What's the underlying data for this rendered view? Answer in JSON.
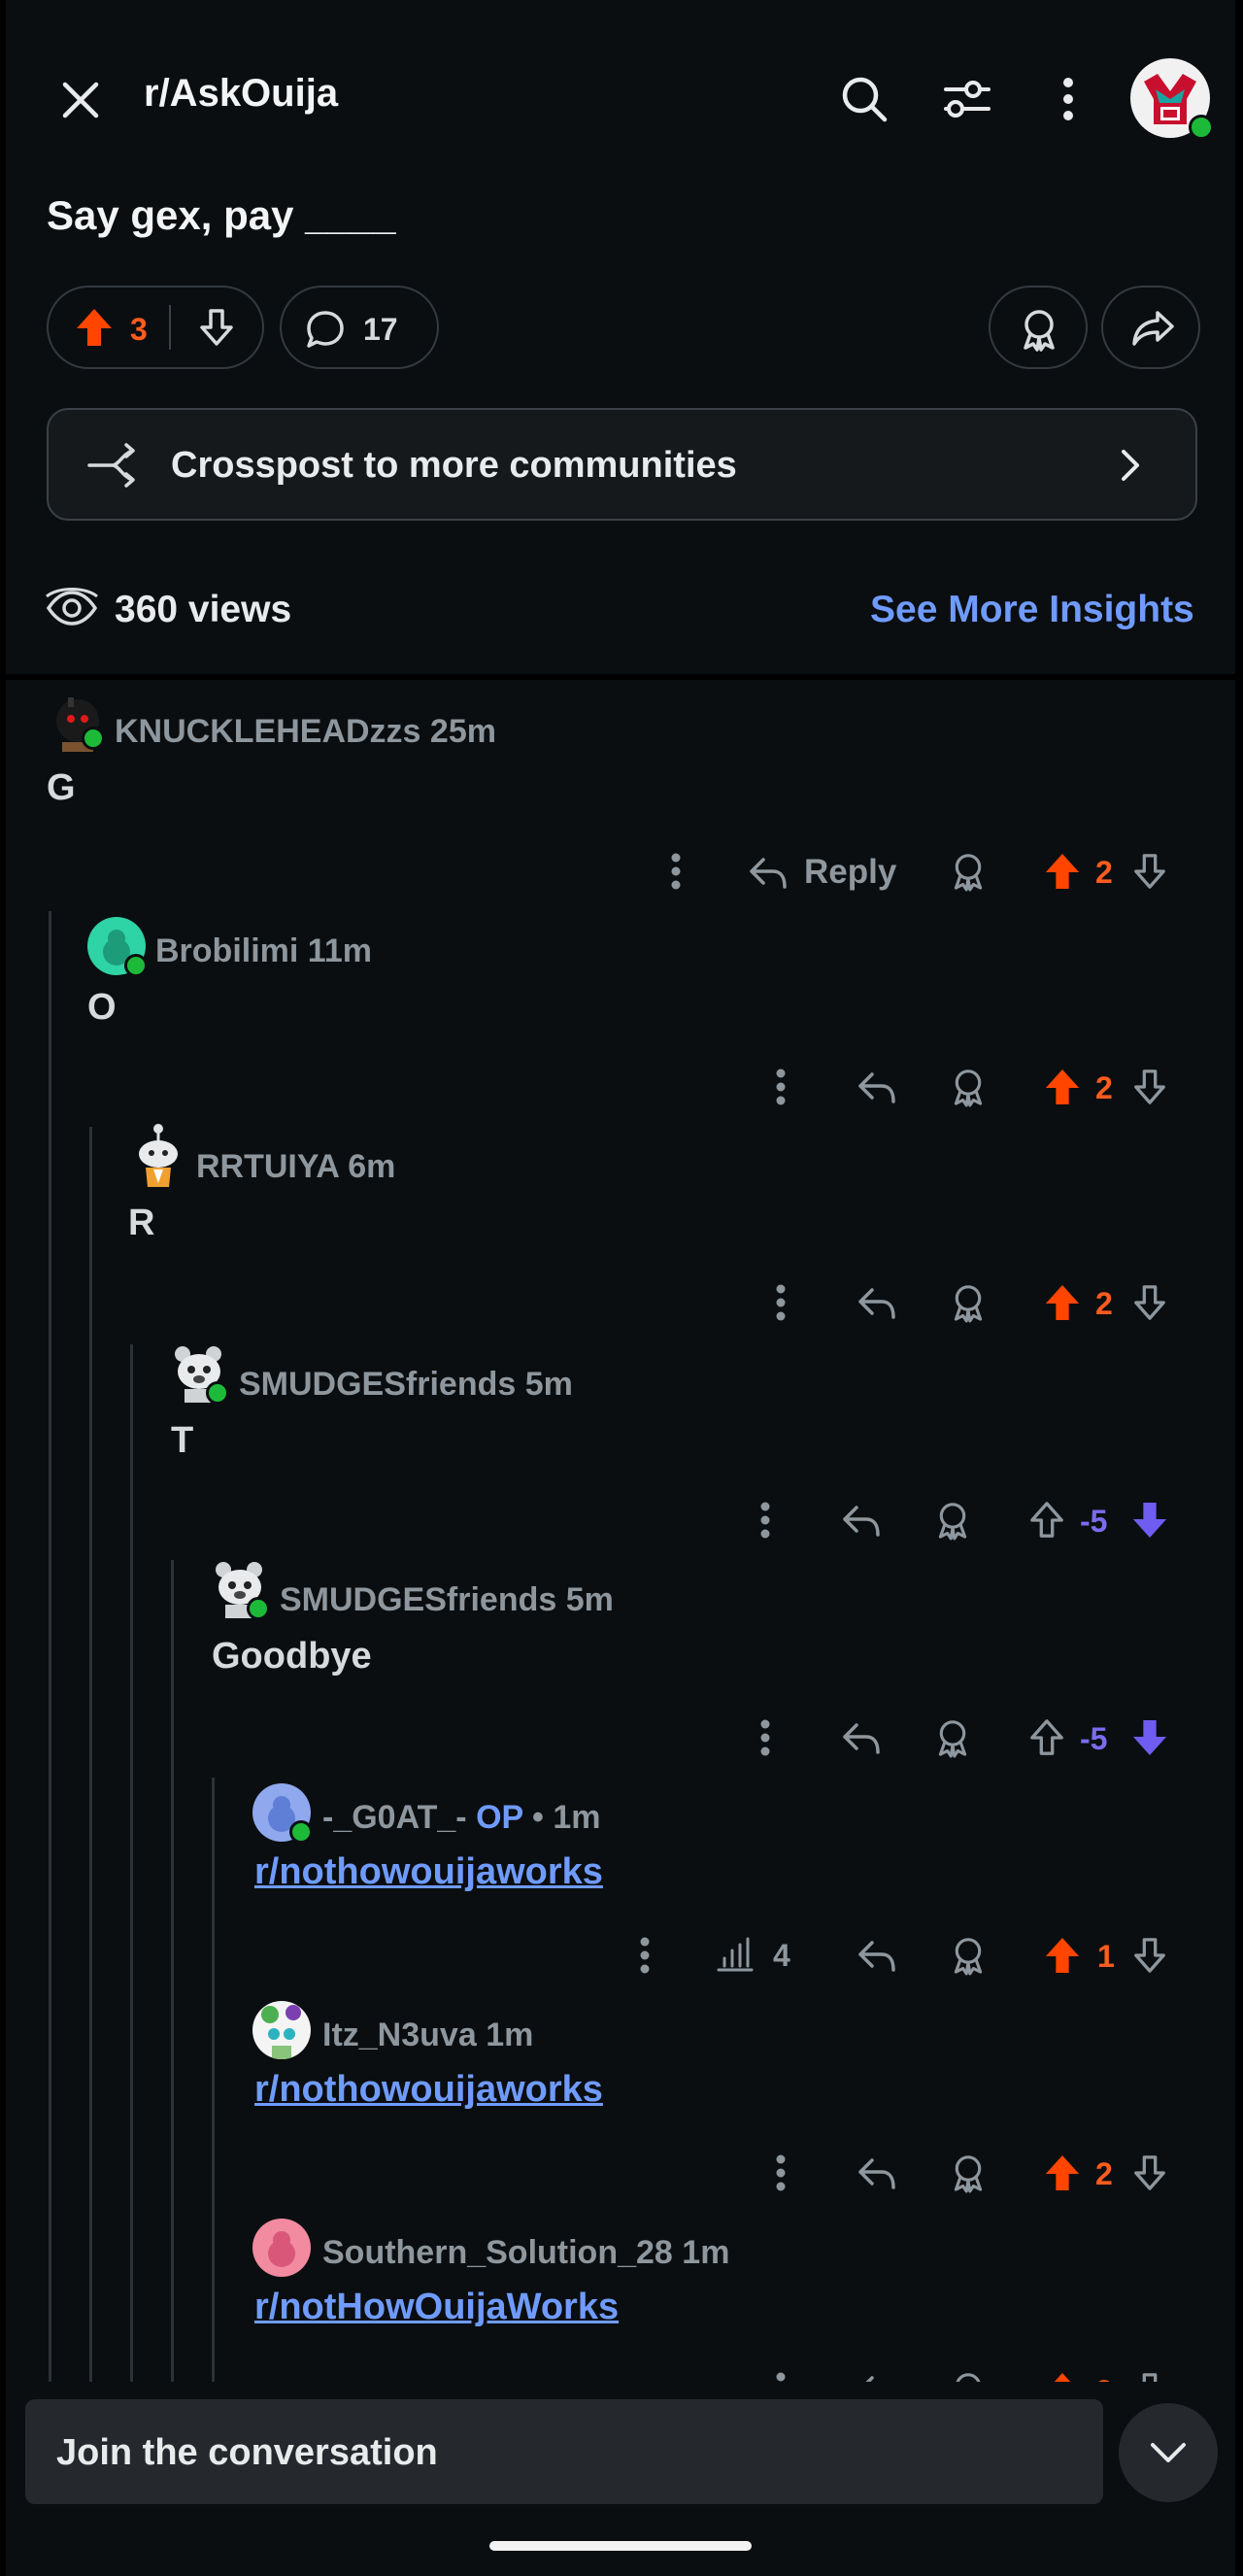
{
  "header": {
    "subreddit": "r/AskOuija",
    "icons": [
      "close-icon",
      "search-icon",
      "filter-icon",
      "more-vertical-icon",
      "user-avatar"
    ]
  },
  "post": {
    "title": "Say gex, pay ____",
    "upvotes": "3",
    "comments": "17",
    "crosspost_label": "Crosspost to more communities",
    "views": "360 views",
    "insights_label": "See More Insights"
  },
  "comments": [
    {
      "user": "KNUCKLEHEADzzs",
      "time": "25m",
      "body": "G",
      "reply": "Reply",
      "score": "2",
      "vote": "up"
    },
    {
      "user": "Brobilimi",
      "time": "11m",
      "body": "O",
      "score": "2",
      "vote": "up"
    },
    {
      "user": "RRTUIYA",
      "time": "6m",
      "body": "R",
      "score": "2",
      "vote": "up"
    },
    {
      "user": "SMUDGESfriends",
      "time": "5m",
      "body": "T",
      "score": "-5",
      "vote": "down"
    },
    {
      "user": "SMUDGESfriends",
      "time": "5m",
      "body": "Goodbye",
      "score": "-5",
      "vote": "down"
    },
    {
      "user": "-_G0AT_-",
      "op": "OP",
      "time": "• 1m",
      "body": "r/nothowouijaworks",
      "stats": "4",
      "score": "1",
      "vote": "up"
    },
    {
      "user": "Itz_N3uva",
      "time": "1m",
      "body": "r/nothowouijaworks",
      "score": "2",
      "vote": "up"
    },
    {
      "user": "Southern_Solution_28",
      "time": "1m",
      "body": "r/notHowOuijaWorks",
      "score": "2",
      "vote": "up"
    }
  ],
  "footer": {
    "placeholder": "Join the conversation"
  },
  "colors": {
    "upvote": "#ff4500",
    "downvote": "#7a6cf0",
    "link": "#6f9bff",
    "online": "#1dba3a"
  }
}
